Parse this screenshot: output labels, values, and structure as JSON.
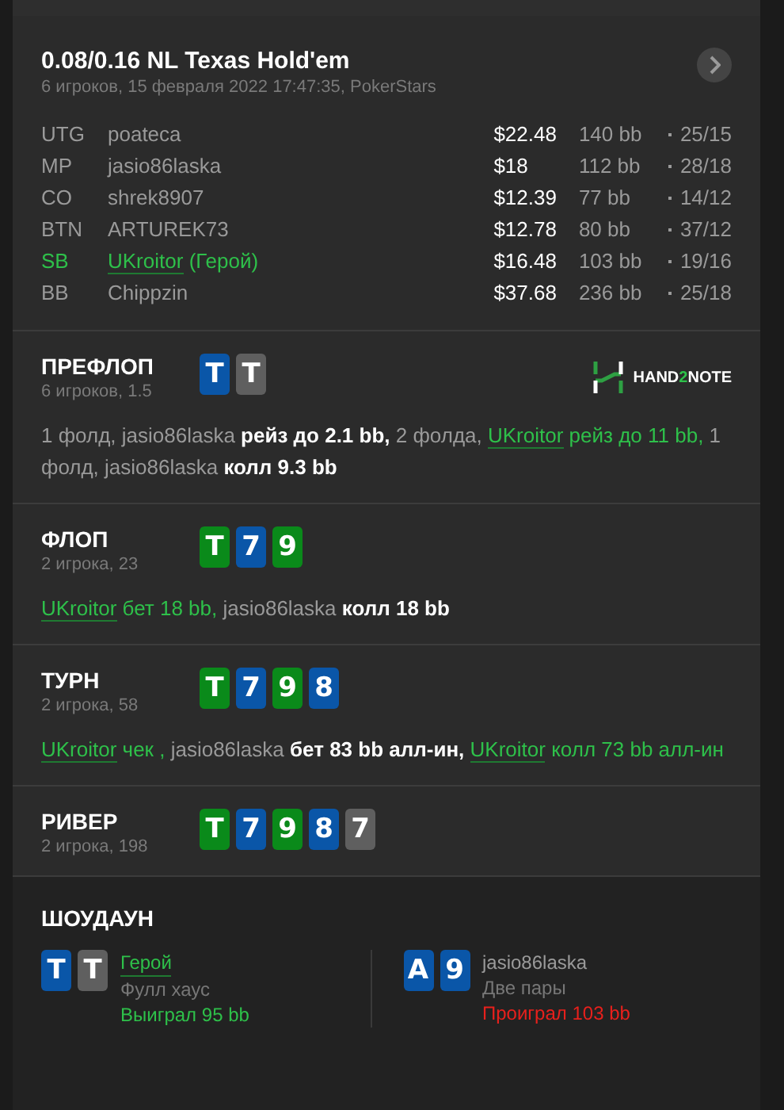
{
  "hand": {
    "title": "0.08/0.16 NL Texas Hold'em",
    "subtitle": "6 игроков, 15 февраля 2022 17:47:35, PokerStars"
  },
  "players": [
    {
      "position": "UTG",
      "name": "poateca",
      "hero": false,
      "stack": "$22.48",
      "bb": "140 bb",
      "ratio": "25/15"
    },
    {
      "position": "MP",
      "name": "jasio86laska",
      "hero": false,
      "stack": "$18",
      "bb": "112 bb",
      "ratio": "28/18"
    },
    {
      "position": "CO",
      "name": "shrek8907",
      "hero": false,
      "stack": "$12.39",
      "bb": "77 bb",
      "ratio": "14/12"
    },
    {
      "position": "BTN",
      "name": "ARTUREK73",
      "hero": false,
      "stack": "$12.78",
      "bb": "80 bb",
      "ratio": "37/12"
    },
    {
      "position": "SB",
      "name": "UKroitor",
      "tag": "(Герой)",
      "hero": true,
      "stack": "$16.48",
      "bb": "103 bb",
      "ratio": "19/16"
    },
    {
      "position": "BB",
      "name": "Chippzin",
      "hero": false,
      "stack": "$37.68",
      "bb": "236 bb",
      "ratio": "25/18"
    }
  ],
  "streets": [
    {
      "title": "ПРЕФЛОП",
      "subtitle": "6 игроков, 1.5",
      "logo": {
        "before": "HAND",
        "accent": "2",
        "after": "NOTE"
      },
      "cards": [
        {
          "rank": "T",
          "color": "#0a56a8"
        },
        {
          "rank": "T",
          "color": "#5f5f5f"
        }
      ],
      "actions": [
        {
          "kind": "plain",
          "text": "1 фолд, jasio86laska "
        },
        {
          "kind": "action",
          "text": "рейз до 2.1 bb,"
        },
        {
          "kind": "plain",
          "text": " 2 фолда, "
        },
        {
          "kind": "hero_name",
          "text": "UKroitor"
        },
        {
          "kind": "hero_action",
          "text": " рейз до 11 bb,"
        },
        {
          "kind": "plain",
          "text": " 1 фолд, jasio86laska "
        },
        {
          "kind": "action",
          "text": "колл 9.3 bb"
        }
      ]
    },
    {
      "title": "ФЛОП",
      "subtitle": "2 игрока, 23",
      "cards": [
        {
          "rank": "T",
          "color": "#0a8a1a"
        },
        {
          "rank": "7",
          "color": "#0a56a8"
        },
        {
          "rank": "9",
          "color": "#0a8a1a"
        }
      ],
      "actions": [
        {
          "kind": "hero_name",
          "text": "UKroitor"
        },
        {
          "kind": "hero_action",
          "text": " бет 18 bb,"
        },
        {
          "kind": "plain",
          "text": " jasio86laska "
        },
        {
          "kind": "action",
          "text": "колл 18 bb"
        }
      ]
    },
    {
      "title": "ТУРН",
      "subtitle": "2 игрока, 58",
      "cards": [
        {
          "rank": "T",
          "color": "#0a8a1a"
        },
        {
          "rank": "7",
          "color": "#0a56a8"
        },
        {
          "rank": "9",
          "color": "#0a8a1a"
        },
        {
          "rank": "8",
          "color": "#0a56a8"
        }
      ],
      "actions": [
        {
          "kind": "hero_name",
          "text": "UKroitor"
        },
        {
          "kind": "hero_action",
          "text": " чек ,"
        },
        {
          "kind": "plain",
          "text": " jasio86laska "
        },
        {
          "kind": "action",
          "text": "бет 83 bb алл-ин, "
        },
        {
          "kind": "hero_name",
          "text": "UKroitor"
        },
        {
          "kind": "hero_action",
          "text": " колл 73 bb алл-ин"
        }
      ]
    },
    {
      "title": "РИВЕР",
      "subtitle": "2 игрока, 198",
      "cards": [
        {
          "rank": "T",
          "color": "#0a8a1a"
        },
        {
          "rank": "7",
          "color": "#0a56a8"
        },
        {
          "rank": "9",
          "color": "#0a8a1a"
        },
        {
          "rank": "8",
          "color": "#0a56a8"
        },
        {
          "rank": "7",
          "color": "#5f5f5f"
        }
      ]
    }
  ],
  "showdown": {
    "title": "ШОУДАУН",
    "players": [
      {
        "name": "Герой",
        "hero": true,
        "cards": [
          {
            "rank": "T",
            "color": "#0a56a8"
          },
          {
            "rank": "T",
            "color": "#5f5f5f"
          }
        ],
        "hand": "Фулл хаус",
        "result": "Выиграл 95 bb",
        "won": true
      },
      {
        "name": "jasio86laska",
        "hero": false,
        "cards": [
          {
            "rank": "A",
            "color": "#0a56a8"
          },
          {
            "rank": "9",
            "color": "#0a56a8"
          }
        ],
        "hand": "Две пары",
        "result": "Проиграл 103 bb",
        "won": false
      }
    ]
  }
}
